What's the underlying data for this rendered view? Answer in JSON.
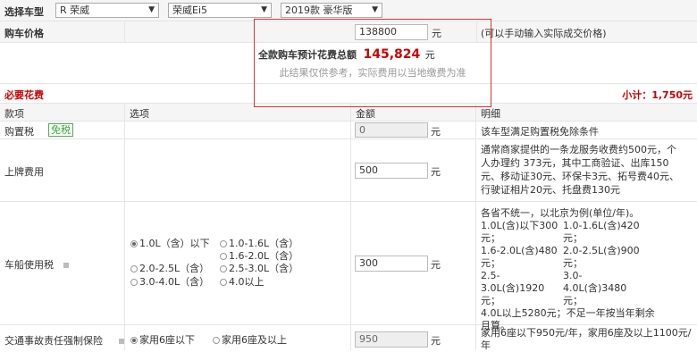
{
  "top": {
    "label": "选择车型",
    "brand": "R 荣威",
    "model": "荣威Ei5",
    "version": "2019款 豪华版"
  },
  "price": {
    "label": "购车价格",
    "value": "138800",
    "unit": "元",
    "hint": "(可以手动输入实际成交价格)"
  },
  "popup": {
    "label": "全款购车预计花费总额",
    "amount": "145,824",
    "unit": "元",
    "note": "此结果仅供参考，实际费用以当地缴费为准"
  },
  "section": {
    "title": "必要花费",
    "subtotal": "小计：1,750元"
  },
  "header": {
    "item": "款项",
    "option": "选项",
    "amount": "金额",
    "detail": "明细"
  },
  "rows": {
    "purchase_tax": {
      "label": "购置税",
      "badge": "免税",
      "value": "0",
      "unit": "元",
      "detail": "该车型满足购置税免除条件"
    },
    "plate": {
      "label": "上牌费用",
      "value": "500",
      "unit": "元",
      "detail": [
        "通常商家提供的一条龙服务收费约500元，个",
        "人办理约 373元，其中工商验证、出库150",
        "元、移动证30元、环保卡3元、拓号费40元、",
        "行驶证相片20元、托盘费130元"
      ]
    },
    "vehicle_tax": {
      "label": "车船使用税",
      "value": "300",
      "unit": "元",
      "options": [
        "1.0L（含）以下",
        "1.0-1.6L（含）",
        "1.6-2.0L（含）",
        "2.0-2.5L（含）",
        "2.5-3.0L（含）",
        "3.0-4.0L（含）",
        "4.0以上"
      ],
      "detail_head": "各省不统一，以北京为例(单位/年)。",
      "detail": [
        [
          "1.0L(含)以下300元；",
          "1.0-1.6L(含)420元；"
        ],
        [
          "1.6-2.0L(含)480元；",
          "2.0-2.5L(含)900元；"
        ],
        [
          "2.5-3.0L(含)1920元；",
          "3.0-4.0L(含)3480元；"
        ]
      ],
      "detail_tail": [
        "4.0L以上5280元；不足一年按当年剩余",
        "月算。"
      ]
    },
    "insurance": {
      "label": "交通事故责任强制保险",
      "value": "950",
      "unit": "元",
      "options": [
        "家用6座以下",
        "家用6座及以上"
      ],
      "detail": "家用6座以下950元/年，家用6座及以上1100元/年"
    }
  }
}
